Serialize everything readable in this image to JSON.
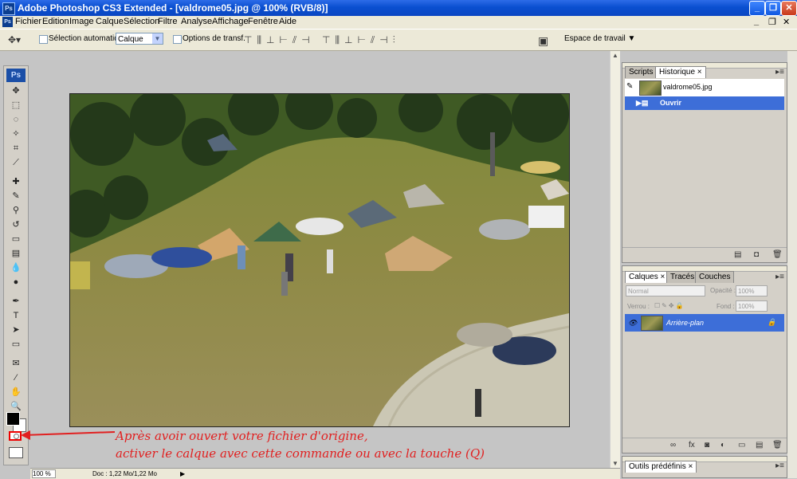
{
  "window": {
    "title": "Adobe Photoshop CS3 Extended - [valdrome05.jpg @ 100% (RVB/8)]",
    "app_icon": "Ps",
    "buttons": {
      "minimize": "_",
      "maximize": "❐",
      "close": "✕"
    }
  },
  "menu": {
    "items": [
      "Fichier",
      "Edition",
      "Image",
      "Calque",
      "Sélection",
      "Filtre",
      "Analyse",
      "Affichage",
      "Fenêtre",
      "Aide"
    ],
    "doc_minimize": "_",
    "doc_restore": "❐",
    "doc_close": "✕"
  },
  "options": {
    "auto_select_label": "Sélection automatique :",
    "auto_select_value": "Calque",
    "transform_label": "Options de transf.",
    "workspace_label": "Espace de travail ▼"
  },
  "toolbox": {
    "logo": "Ps",
    "tools": [
      {
        "name": "move-tool-icon",
        "glyph": "✥"
      },
      {
        "name": "marquee-tool-icon",
        "glyph": "⬚"
      },
      {
        "name": "lasso-tool-icon",
        "glyph": "◌"
      },
      {
        "name": "magic-wand-icon",
        "glyph": "✧"
      },
      {
        "name": "crop-tool-icon",
        "glyph": "⌗"
      },
      {
        "name": "slice-tool-icon",
        "glyph": "⟋"
      },
      {
        "name": "healing-brush-icon",
        "glyph": "✚"
      },
      {
        "name": "brush-tool-icon",
        "glyph": "✎"
      },
      {
        "name": "clone-stamp-icon",
        "glyph": "⚲"
      },
      {
        "name": "history-brush-icon",
        "glyph": "↺"
      },
      {
        "name": "eraser-tool-icon",
        "glyph": "▭"
      },
      {
        "name": "gradient-tool-icon",
        "glyph": "▤"
      },
      {
        "name": "blur-tool-icon",
        "glyph": "💧"
      },
      {
        "name": "dodge-tool-icon",
        "glyph": "●"
      },
      {
        "name": "pen-tool-icon",
        "glyph": "✒"
      },
      {
        "name": "type-tool-icon",
        "glyph": "T"
      },
      {
        "name": "path-select-icon",
        "glyph": "➤"
      },
      {
        "name": "shape-tool-icon",
        "glyph": "▭"
      },
      {
        "name": "notes-tool-icon",
        "glyph": "✉"
      },
      {
        "name": "eyedropper-icon",
        "glyph": "⁄"
      },
      {
        "name": "hand-tool-icon",
        "glyph": "✋"
      },
      {
        "name": "zoom-tool-icon",
        "glyph": "🔍"
      }
    ]
  },
  "annotation": {
    "line1": "Après avoir ouvert votre fichier d'origine,",
    "line2": "activer le calque avec cette commande ou avec la touche (Q)",
    "color": "#e12020"
  },
  "status": {
    "zoom": "100 %",
    "doc": "Doc : 1,22 Mo/1,22 Mo"
  },
  "history_panel": {
    "tabs": [
      "Scripts",
      "Historique ×"
    ],
    "snapshot": "valdrome05.jpg",
    "steps": [
      "Ouvrir"
    ]
  },
  "layers_panel": {
    "tabs": [
      "Calques ×",
      "Tracés",
      "Couches"
    ],
    "blend_mode": "Normal",
    "opacity_label": "Opacité :",
    "opacity_value": "100%",
    "lock_label": "Verrou :",
    "fill_label": "Fond :",
    "fill_value": "100%",
    "layers": [
      "Arrière-plan"
    ]
  },
  "presets_panel": {
    "tab": "Outils prédéfinis ×"
  }
}
